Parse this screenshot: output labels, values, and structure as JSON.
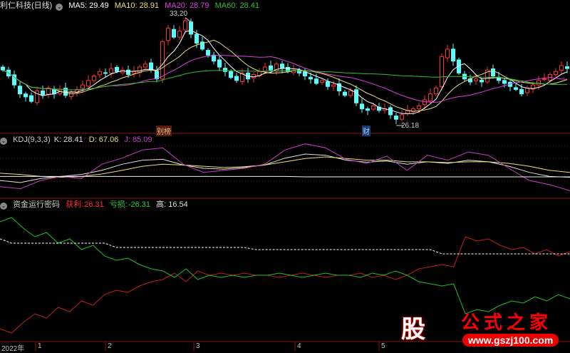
{
  "header": {
    "stock": "利仁科技(日线)",
    "ma5": "MA5: 29.49",
    "ma10": "MA10: 28.91",
    "ma20": "MA20: 28.79",
    "ma60": "MA60: 28.41"
  },
  "annotations": {
    "high": "33.20",
    "low": "26.18",
    "tag1": "别榜",
    "tag2": "财"
  },
  "kdj_header": {
    "name": "KDJ(9,3,3)",
    "k": "K: 28.41",
    "d": "D: 67.06",
    "j": "J: 85.09"
  },
  "fund_header": {
    "name": "资金运行密码",
    "profit_label": "获利:",
    "profit": "26.31",
    "loss_label": "亏损:",
    "loss": "-26.31",
    "high": "高: 16.54"
  },
  "x_axis": [
    "2022年",
    "1",
    "2",
    "3",
    "4",
    "5"
  ],
  "watermark": {
    "logo": "股",
    "title": "公式之家",
    "url": "www.gszj100.com"
  },
  "colors": {
    "up": "#ff3030",
    "down": "#54ffff",
    "ma5": "#ffffff",
    "ma10": "#e8e070",
    "ma20": "#e040e0",
    "ma60": "#30c030",
    "profit": "#c02020",
    "loss": "#20c020"
  },
  "chart_data": [
    {
      "type": "candlestick",
      "title": "利仁科技(日线)",
      "close": [
        29.6,
        29.2,
        28.6,
        28.0,
        27.8,
        27.5,
        28.2,
        27.9,
        28.4,
        28.0,
        28.3,
        27.9,
        28.1,
        28.3,
        28.6,
        28.9,
        29.2,
        29.5,
        29.4,
        29.7,
        29.5,
        29.6,
        29.3,
        29.5,
        29.8,
        30.0,
        29.6,
        29.0,
        31.5,
        32.4,
        31.8,
        32.2,
        32.9,
        32.0,
        31.4,
        31.0,
        30.6,
        30.2,
        29.8,
        29.5,
        29.1,
        28.9,
        29.4,
        29.0,
        29.3,
        29.5,
        29.8,
        29.6,
        30.0,
        29.7,
        29.5,
        29.6,
        29.4,
        29.2,
        29.0,
        28.7,
        28.9,
        28.5,
        28.6,
        28.2,
        27.9,
        28.2,
        27.4,
        27.0,
        26.9,
        27.2,
        26.9,
        27.0,
        26.6,
        26.3,
        26.6,
        26.9,
        27.0,
        27.2,
        27.6,
        28.0,
        28.4,
        30.5,
        31.0,
        30.2,
        29.4,
        29.0,
        28.8,
        29.0,
        28.8,
        29.6,
        29.2,
        28.9,
        28.7,
        28.5,
        28.3,
        28.0,
        28.4,
        28.6,
        28.9,
        29.0,
        29.3,
        29.5,
        29.9,
        29.7
      ],
      "ylim": [
        25.5,
        34.1
      ],
      "max_label": 33.2,
      "min_label": 26.18,
      "ma_periods": [
        5,
        10,
        20,
        60
      ]
    },
    {
      "type": "line",
      "title": "KDJ(9,3,3)",
      "ylim": [
        -20,
        120
      ],
      "series": [
        {
          "name": "K",
          "values": [
            20,
            15,
            25,
            30,
            35,
            45,
            60,
            70,
            72,
            58,
            50,
            48,
            52,
            58,
            75,
            85,
            82,
            70,
            65,
            68,
            60,
            66,
            62,
            70,
            66,
            55,
            40,
            30,
            28
          ]
        },
        {
          "name": "D",
          "values": [
            38,
            35,
            30,
            28,
            30,
            36,
            45,
            55,
            60,
            58,
            55,
            52,
            54,
            58,
            66,
            74,
            78,
            74,
            70,
            70,
            66,
            66,
            64,
            66,
            66,
            62,
            55,
            45,
            40
          ]
        },
        {
          "name": "J",
          "values": [
            5,
            0,
            20,
            30,
            25,
            60,
            75,
            95,
            100,
            60,
            40,
            45,
            50,
            60,
            95,
            110,
            100,
            72,
            62,
            80,
            45,
            82,
            70,
            90,
            82,
            50,
            20,
            10,
            -5
          ]
        },
        {
          "name": "ref",
          "values": [
            30,
            30,
            30,
            30,
            30,
            30,
            30,
            30,
            30,
            30,
            30,
            30,
            30,
            30,
            30,
            29,
            29,
            29,
            29,
            29,
            29,
            29,
            29,
            29,
            29,
            29,
            29,
            29,
            29
          ]
        }
      ]
    },
    {
      "type": "line",
      "title": "资金运行密码",
      "ylim": [
        -30,
        30
      ],
      "series": [
        {
          "name": "获利",
          "values": [
            -25,
            -27,
            -22,
            -18,
            -20,
            -15,
            -17,
            -12,
            -14,
            -9,
            -7,
            -8,
            -5,
            -3,
            -2,
            1,
            -3,
            2,
            0,
            1,
            0,
            1,
            0,
            0,
            -1,
            0,
            1,
            0,
            -1,
            0,
            0,
            1,
            -1,
            0,
            -2,
            0,
            3,
            4,
            5,
            4,
            18,
            16,
            17,
            14,
            12,
            13,
            10,
            12,
            9,
            11
          ]
        },
        {
          "name": "亏损",
          "values": [
            25,
            27,
            22,
            18,
            20,
            15,
            17,
            12,
            14,
            9,
            7,
            8,
            5,
            3,
            2,
            -1,
            3,
            -2,
            0,
            -1,
            0,
            -1,
            0,
            0,
            1,
            0,
            -1,
            0,
            1,
            0,
            0,
            -1,
            1,
            0,
            2,
            0,
            -3,
            -4,
            -5,
            -4,
            -18,
            -16,
            -17,
            -14,
            -12,
            -13,
            -10,
            -12,
            -9,
            -11
          ]
        },
        {
          "name": "高",
          "values": [
            17,
            15,
            15,
            15,
            15,
            15,
            15,
            15,
            15,
            15,
            13,
            13,
            13,
            13,
            13,
            13,
            13,
            13,
            13,
            13,
            13,
            13,
            12,
            12,
            12,
            12,
            12,
            12,
            12,
            12,
            12,
            12,
            12,
            12,
            12,
            12,
            12,
            12,
            10,
            10,
            10,
            10,
            10,
            10,
            10,
            10,
            10,
            10,
            10,
            10
          ]
        }
      ]
    }
  ]
}
